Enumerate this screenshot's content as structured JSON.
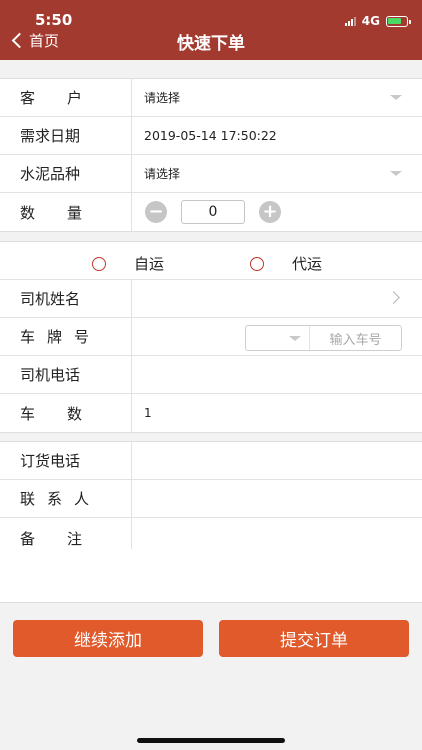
{
  "status_bar": {
    "time": "5:50",
    "network": "4G"
  },
  "header": {
    "back_label": "首页",
    "title": "快速下单"
  },
  "order": {
    "customer": {
      "label": "客户",
      "value": "请选择"
    },
    "date": {
      "label": "需求日期",
      "value": "2019-05-14 17:50:22"
    },
    "cement_type": {
      "label": "水泥品种",
      "value": "请选择"
    },
    "quantity": {
      "label": "数量",
      "value": "0",
      "minus": "−",
      "plus": "+"
    }
  },
  "transport": {
    "options": [
      "自运",
      "代运"
    ],
    "driver_name": {
      "label": "司机姓名",
      "value": ""
    },
    "plate": {
      "label": "车牌号",
      "prefix": "",
      "placeholder": "输入车号"
    },
    "driver_phone": {
      "label": "司机电话",
      "value": ""
    },
    "vehicle_count": {
      "label": "车数",
      "value": "1"
    }
  },
  "contact": {
    "order_phone": {
      "label": "订货电话",
      "value": ""
    },
    "contact_person": {
      "label": "联系人",
      "value": ""
    },
    "remark": {
      "label": "备注",
      "value": ""
    }
  },
  "actions": {
    "continue_label": "继续添加",
    "submit_label": "提交订单"
  },
  "colors": {
    "header": "#a33a2f",
    "button": "#e05a2b",
    "radio": "#c0392b"
  }
}
